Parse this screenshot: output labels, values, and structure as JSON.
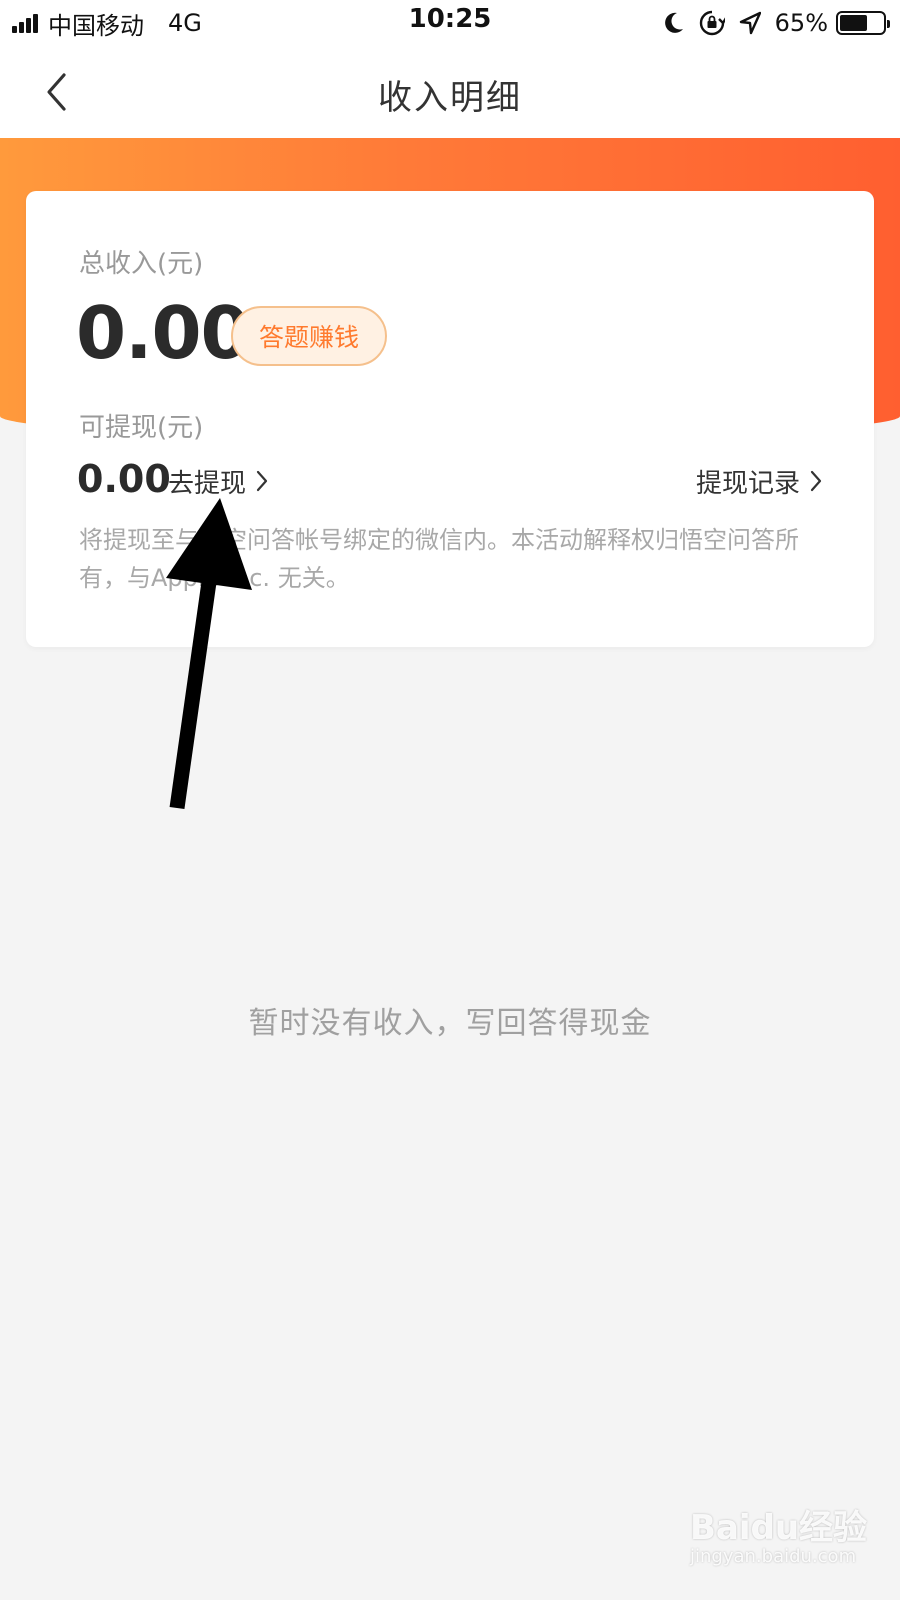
{
  "status_bar": {
    "carrier": "中国移动",
    "network": "4G",
    "time": "10:25",
    "battery_percent": "65%",
    "battery_level": 0.65,
    "icons": [
      "signal-icon",
      "moon-icon",
      "rotation-lock-icon",
      "location-icon",
      "battery-icon"
    ]
  },
  "nav": {
    "title": "收入明细",
    "back_icon": "chevron-left-icon"
  },
  "card": {
    "total_label": "总收入(元)",
    "total_value": "0.00",
    "earn_button": "答题赚钱",
    "withdrawable_label": "可提现(元)",
    "withdrawable_value": "0.00",
    "go_withdraw": "去提现",
    "withdraw_history": "提现记录",
    "notice": "将提现至与悟空问答帐号绑定的微信内。本活动解释权归悟空问答所有，与Apple Inc. 无关。"
  },
  "empty_state": {
    "message": "暂时没有收入，写回答得现金"
  },
  "watermark": {
    "main": "Baidu经验",
    "sub": "jingyan.baidu.com"
  },
  "colors": {
    "accent": "#ff7a2e",
    "header_start": "#ff9a3c",
    "header_end": "#ff5f30",
    "background": "#f4f4f4"
  }
}
